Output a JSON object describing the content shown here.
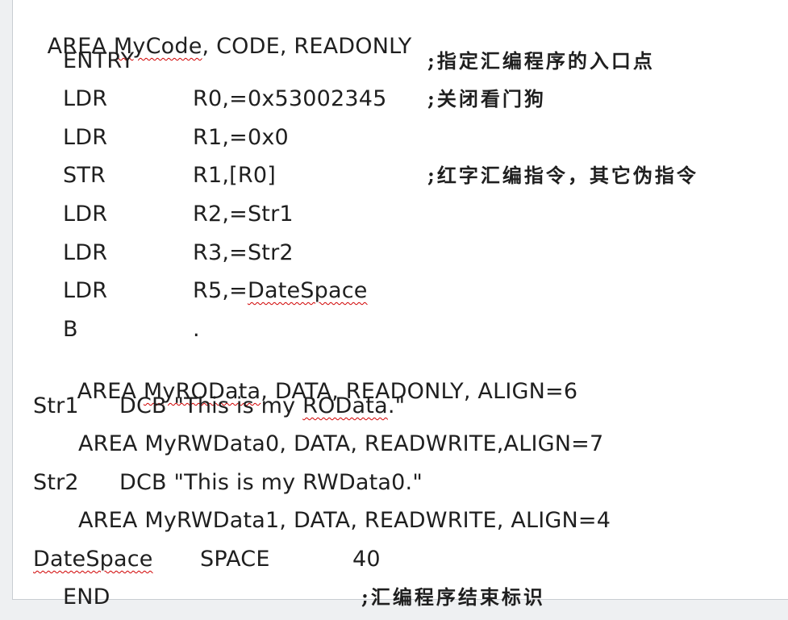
{
  "code": {
    "l01": {
      "a": "AREA ",
      "b": "MyCode",
      "c": ", CODE, READONLY"
    },
    "l02": {
      "op": "ENTRY",
      "cmt": ";指定汇编程序的入口点"
    },
    "l03": {
      "op": "LDR",
      "arg": "R0,=0x53002345",
      "cmt": ";关闭看门狗"
    },
    "l04": {
      "op": "LDR",
      "arg": "R1,=0x0"
    },
    "l05": {
      "op": "STR",
      "arg": "R1,[R0]",
      "cmt": ";红字汇编指令，其它伪指令"
    },
    "l06": {
      "op": "LDR",
      "arg": "R2,=Str1"
    },
    "l07": {
      "op": "LDR",
      "arg": "R3,=Str2"
    },
    "l08": {
      "op": "LDR",
      "arg_a": "R5,=",
      "arg_b": "DateSpace"
    },
    "l09": {
      "op": "B",
      "arg": "."
    },
    "l10": {
      "a": "AREA ",
      "b": "MyROData",
      "c": ", DATA, READONLY, ALIGN=6"
    },
    "l11": {
      "label": "Str1",
      "a": "DCB \"This is my ",
      "b": "ROData",
      "c": ".\""
    },
    "l12": {
      "text": "AREA MyRWData0, DATA, READWRITE,ALIGN=7"
    },
    "l13": {
      "label": "Str2",
      "text": "DCB \"This is my RWData0.\""
    },
    "l14": {
      "text": "AREA MyRWData1, DATA, READWRITE, ALIGN=4"
    },
    "l15": {
      "label": "DateSpace",
      "op": "SPACE",
      "arg": "40"
    },
    "l16": {
      "op": "END",
      "cmt": ";汇编程序结束标识"
    }
  }
}
